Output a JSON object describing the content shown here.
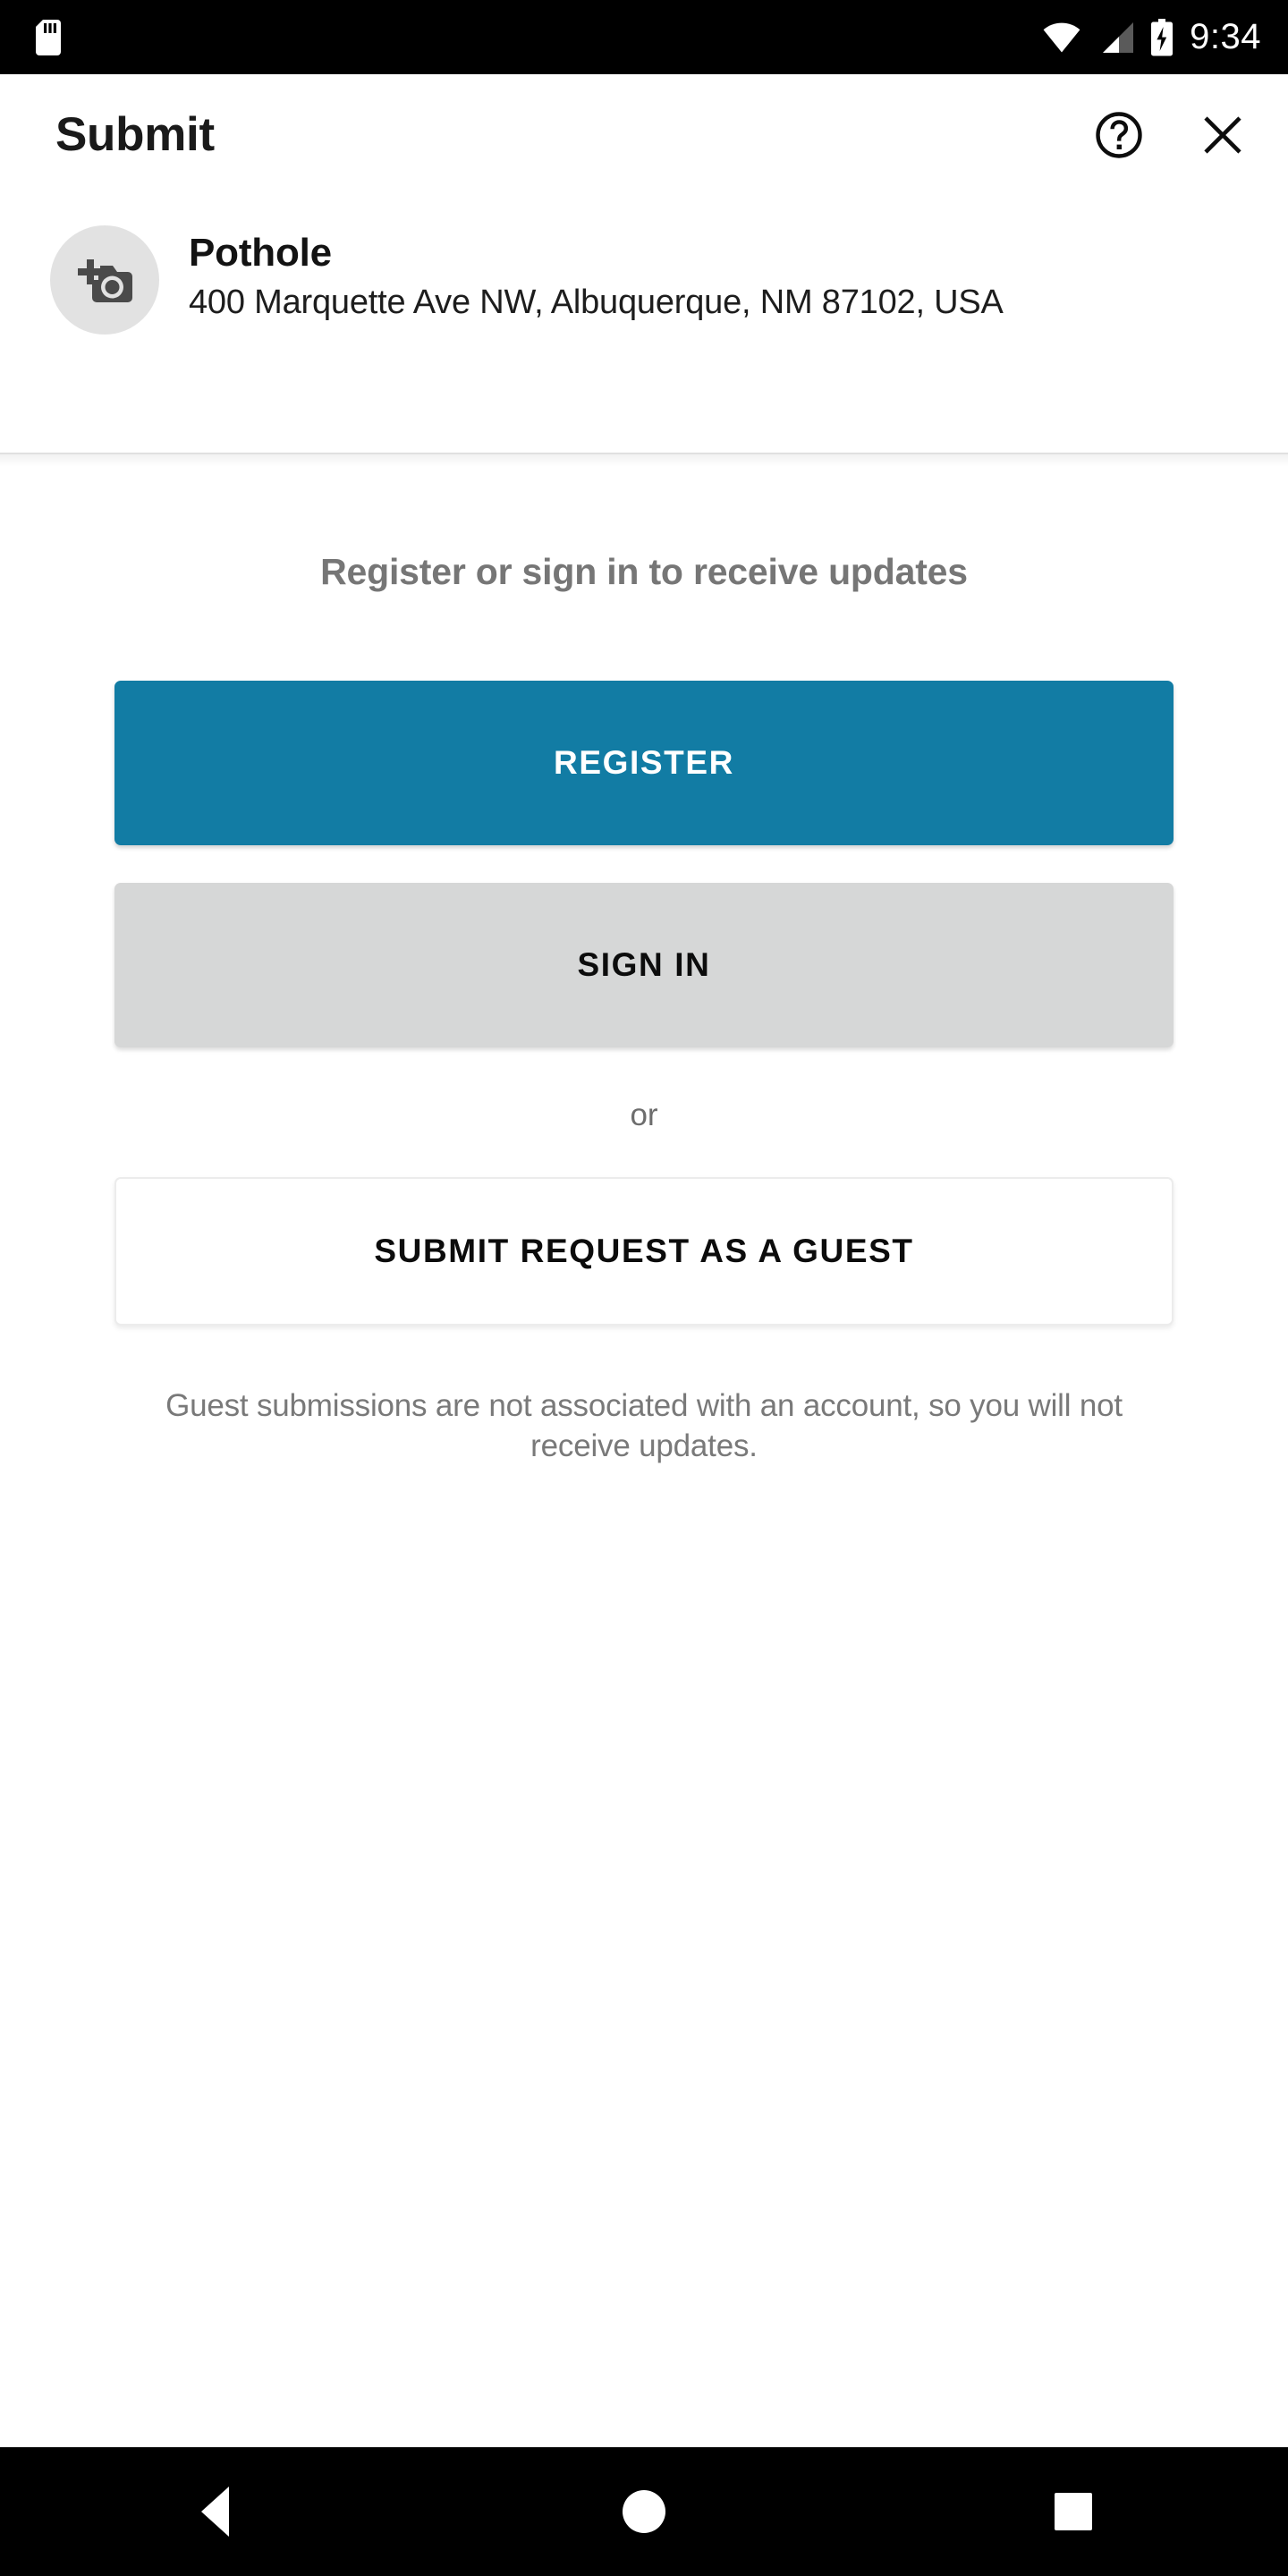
{
  "status_bar": {
    "sim_icon": "sim-card-icon",
    "wifi_icon": "wifi-icon",
    "signal_icon": "cellular-signal-icon",
    "battery_icon": "battery-charging-icon",
    "time": "9:34"
  },
  "app_bar": {
    "title": "Submit",
    "help_icon": "help-circle-icon",
    "close_icon": "close-icon"
  },
  "item": {
    "photo_placeholder_icon": "add-a-photo-icon",
    "title": "Pothole",
    "address": "400 Marquette Ave NW, Albuquerque, NM 87102, USA"
  },
  "main": {
    "prompt": "Register or sign in to receive updates",
    "register_label": "REGISTER",
    "signin_label": "SIGN IN",
    "or_label": "or",
    "guest_label": "SUBMIT REQUEST AS A GUEST",
    "guest_note": "Guest submissions are not associated with an account, so you will not receive updates."
  },
  "nav_bar": {
    "back_icon": "back-triangle-icon",
    "home_icon": "home-circle-icon",
    "recents_icon": "recents-square-icon"
  },
  "colors": {
    "accent": "#127CA4",
    "signin_bg": "#d6d7d7",
    "prompt_text": "#767676",
    "note_text": "#797979",
    "system_bar": "#000000",
    "page_bg": "#ffffff"
  }
}
